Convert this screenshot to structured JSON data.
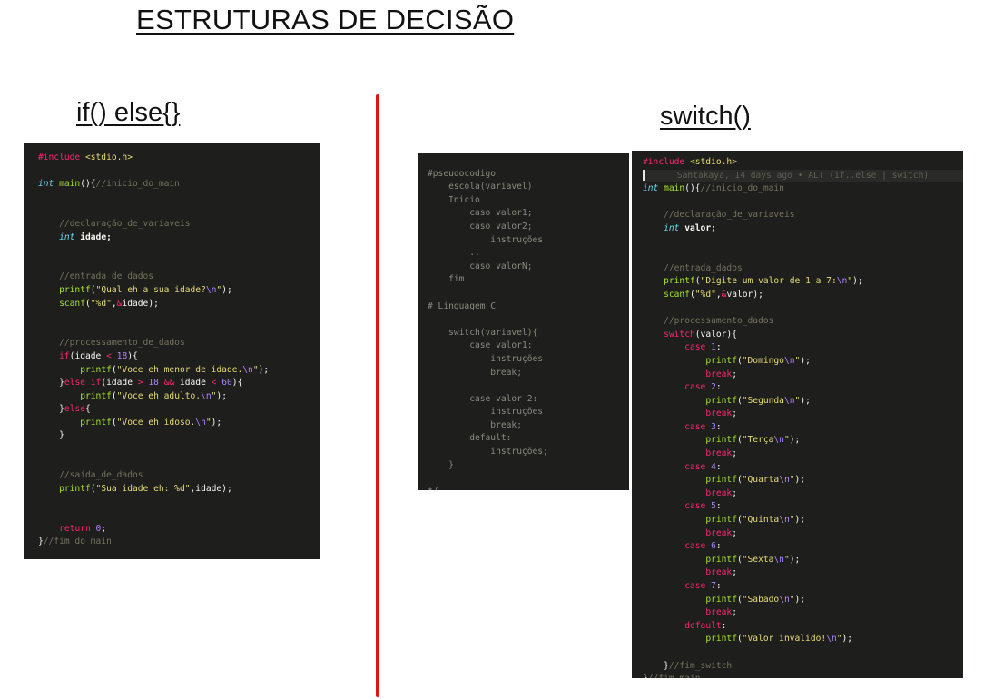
{
  "page": {
    "title": "ESTRUTURAS DE DECISÃO",
    "left_heading": "if()  else{}",
    "right_heading": "switch()"
  },
  "colors": {
    "divider": "#e01515",
    "editor_bg": "#1e1f1c",
    "keyword": "#f92672",
    "type": "#66d9ef",
    "function": "#a6e22e",
    "string": "#e6db74",
    "number": "#ae81ff",
    "comment": "#75715e"
  },
  "if_else_code": [
    [
      [
        "kw",
        "#include "
      ],
      [
        "st",
        "<stdio.h>"
      ]
    ],
    [],
    [
      [
        "ty",
        "int "
      ],
      [
        "fn",
        "main"
      ],
      [
        "pl",
        "(){"
      ],
      [
        "cm",
        "//inicio_do_main"
      ]
    ],
    [],
    [],
    [
      [
        "pl",
        "    "
      ],
      [
        "cm",
        "//declaração_de_variaveis"
      ]
    ],
    [
      [
        "pl",
        "    "
      ],
      [
        "ty",
        "int "
      ],
      [
        "bd",
        "idade;"
      ]
    ],
    [],
    [],
    [
      [
        "pl",
        "    "
      ],
      [
        "cm",
        "//entrada_de_dados"
      ]
    ],
    [
      [
        "pl",
        "    "
      ],
      [
        "fn",
        "printf"
      ],
      [
        "pl",
        "("
      ],
      [
        "st",
        "\"Qual eh a sua idade?"
      ],
      [
        "nu",
        "\\n"
      ],
      [
        "st",
        "\""
      ],
      [
        "pl",
        ");"
      ]
    ],
    [
      [
        "pl",
        "    "
      ],
      [
        "fn",
        "scanf"
      ],
      [
        "pl",
        "("
      ],
      [
        "st",
        "\"%d\""
      ],
      [
        "pl",
        ","
      ],
      [
        "kw",
        "&"
      ],
      [
        "pl",
        "idade);"
      ]
    ],
    [],
    [],
    [
      [
        "pl",
        "    "
      ],
      [
        "cm",
        "//processamento_de_dados"
      ]
    ],
    [
      [
        "pl",
        "    "
      ],
      [
        "kw",
        "if"
      ],
      [
        "pl",
        "(idade "
      ],
      [
        "kw",
        "< "
      ],
      [
        "nu",
        "18"
      ],
      [
        "pl",
        ")"
      ],
      [
        "pl",
        "{"
      ]
    ],
    [
      [
        "pl",
        "        "
      ],
      [
        "fn",
        "printf"
      ],
      [
        "pl",
        "("
      ],
      [
        "st",
        "\"Voce eh menor de idade."
      ],
      [
        "nu",
        "\\n"
      ],
      [
        "st",
        "\""
      ],
      [
        "pl",
        ");"
      ]
    ],
    [
      [
        "pl",
        "    "
      ],
      [
        "pl",
        "}"
      ],
      [
        "kw",
        "else if"
      ],
      [
        "pl",
        "(idade "
      ],
      [
        "kw",
        "> "
      ],
      [
        "nu",
        "18 "
      ],
      [
        "kw",
        "&& "
      ],
      [
        "pl",
        "idade "
      ],
      [
        "kw",
        "< "
      ],
      [
        "nu",
        "60"
      ],
      [
        "pl",
        "){"
      ]
    ],
    [
      [
        "pl",
        "        "
      ],
      [
        "fn",
        "printf"
      ],
      [
        "pl",
        "("
      ],
      [
        "st",
        "\"Voce eh adulto."
      ],
      [
        "nu",
        "\\n"
      ],
      [
        "st",
        "\""
      ],
      [
        "pl",
        ");"
      ]
    ],
    [
      [
        "pl",
        "    "
      ],
      [
        "pl",
        "}"
      ],
      [
        "kw",
        "else"
      ],
      [
        "pl",
        "{"
      ]
    ],
    [
      [
        "pl",
        "        "
      ],
      [
        "fn",
        "printf"
      ],
      [
        "pl",
        "("
      ],
      [
        "st",
        "\"Voce eh idoso."
      ],
      [
        "nu",
        "\\n"
      ],
      [
        "st",
        "\""
      ],
      [
        "pl",
        ");"
      ]
    ],
    [
      [
        "pl",
        "    }"
      ]
    ],
    [],
    [],
    [
      [
        "pl",
        "    "
      ],
      [
        "cm",
        "//saida_de_dados"
      ]
    ],
    [
      [
        "pl",
        "    "
      ],
      [
        "fn",
        "printf"
      ],
      [
        "pl",
        "("
      ],
      [
        "st",
        "\"Sua idade eh: %d\""
      ],
      [
        "pl",
        ",idade);"
      ]
    ],
    [],
    [],
    [
      [
        "pl",
        "    "
      ],
      [
        "kw",
        "return "
      ],
      [
        "nu",
        "0"
      ],
      [
        "pl",
        ";"
      ]
    ],
    [
      [
        "pl",
        "}"
      ],
      [
        "cm",
        "//fim_do_main"
      ]
    ]
  ],
  "pseudo_code": [
    [],
    [
      [
        "ps",
        "#pseudocodigo"
      ]
    ],
    [
      [
        "ps",
        "    escola(variavel)"
      ]
    ],
    [
      [
        "ps",
        "    Inicio"
      ]
    ],
    [
      [
        "ps",
        "        caso valor1;"
      ]
    ],
    [
      [
        "ps",
        "        caso valor2;"
      ]
    ],
    [
      [
        "ps",
        "            instruções"
      ]
    ],
    [
      [
        "ps",
        "        .."
      ]
    ],
    [
      [
        "ps",
        "        caso valorN;"
      ]
    ],
    [
      [
        "ps",
        "    fim"
      ]
    ],
    [],
    [
      [
        "ps",
        "# Linguagem C"
      ]
    ],
    [],
    [
      [
        "ps",
        "    switch(variavel){"
      ]
    ],
    [
      [
        "ps",
        "        case valor1:"
      ]
    ],
    [
      [
        "ps",
        "            instruções"
      ]
    ],
    [
      [
        "ps",
        "            break;"
      ]
    ],
    [],
    [
      [
        "ps",
        "        case valor 2:"
      ]
    ],
    [
      [
        "ps",
        "            instruções"
      ]
    ],
    [
      [
        "ps",
        "            break;"
      ]
    ],
    [
      [
        "ps",
        "        default:"
      ]
    ],
    [
      [
        "ps",
        "            instruções;"
      ]
    ],
    [
      [
        "ps",
        "    }"
      ]
    ],
    [],
    [
      [
        "ps",
        "*/"
      ]
    ]
  ],
  "switch_blame": "     Santakaya, 14 days ago • ALT (if..else | switch)",
  "switch_code": [
    [
      [
        "kw",
        "#include "
      ],
      [
        "st",
        "<stdio.h>"
      ]
    ],
    "BLAME",
    [
      [
        "ty",
        "int "
      ],
      [
        "fn",
        "main"
      ],
      [
        "pl",
        "(){"
      ],
      [
        "cm",
        "//inicio_do_main"
      ]
    ],
    [],
    [
      [
        "pl",
        "    "
      ],
      [
        "cm",
        "//declaração_de_variaveis"
      ]
    ],
    [
      [
        "pl",
        "    "
      ],
      [
        "ty",
        "int "
      ],
      [
        "bd",
        "valor;"
      ]
    ],
    [],
    [],
    [
      [
        "pl",
        "    "
      ],
      [
        "cm",
        "//entrada_dados"
      ]
    ],
    [
      [
        "pl",
        "    "
      ],
      [
        "fn",
        "printf"
      ],
      [
        "pl",
        "("
      ],
      [
        "st",
        "\"Digite um valor de 1 a 7:"
      ],
      [
        "nu",
        "\\n"
      ],
      [
        "st",
        "\""
      ],
      [
        "pl",
        ");"
      ]
    ],
    [
      [
        "pl",
        "    "
      ],
      [
        "fn",
        "scanf"
      ],
      [
        "pl",
        "("
      ],
      [
        "st",
        "\"%d\""
      ],
      [
        "pl",
        ","
      ],
      [
        "kw",
        "&"
      ],
      [
        "pl",
        "valor);"
      ]
    ],
    [],
    [
      [
        "pl",
        "    "
      ],
      [
        "cm",
        "//processamento_dados"
      ]
    ],
    [
      [
        "pl",
        "    "
      ],
      [
        "kw",
        "switch"
      ],
      [
        "pl",
        "(valor){"
      ]
    ],
    [
      [
        "pl",
        "        "
      ],
      [
        "kw",
        "case "
      ],
      [
        "nu",
        "1"
      ],
      [
        "pl",
        ":"
      ]
    ],
    [
      [
        "pl",
        "            "
      ],
      [
        "fn",
        "printf"
      ],
      [
        "pl",
        "("
      ],
      [
        "st",
        "\"Domingo"
      ],
      [
        "nu",
        "\\n"
      ],
      [
        "st",
        "\""
      ],
      [
        "pl",
        ");"
      ]
    ],
    [
      [
        "pl",
        "            "
      ],
      [
        "kw",
        "break"
      ],
      [
        "pl",
        ";"
      ]
    ],
    [
      [
        "pl",
        "        "
      ],
      [
        "kw",
        "case "
      ],
      [
        "nu",
        "2"
      ],
      [
        "pl",
        ":"
      ]
    ],
    [
      [
        "pl",
        "            "
      ],
      [
        "fn",
        "printf"
      ],
      [
        "pl",
        "("
      ],
      [
        "st",
        "\"Segunda"
      ],
      [
        "nu",
        "\\n"
      ],
      [
        "st",
        "\""
      ],
      [
        "pl",
        ");"
      ]
    ],
    [
      [
        "pl",
        "            "
      ],
      [
        "kw",
        "break"
      ],
      [
        "pl",
        ";"
      ]
    ],
    [
      [
        "pl",
        "        "
      ],
      [
        "kw",
        "case "
      ],
      [
        "nu",
        "3"
      ],
      [
        "pl",
        ":"
      ]
    ],
    [
      [
        "pl",
        "            "
      ],
      [
        "fn",
        "printf"
      ],
      [
        "pl",
        "("
      ],
      [
        "st",
        "\"Terça"
      ],
      [
        "nu",
        "\\n"
      ],
      [
        "st",
        "\""
      ],
      [
        "pl",
        ");"
      ]
    ],
    [
      [
        "pl",
        "            "
      ],
      [
        "kw",
        "break"
      ],
      [
        "pl",
        ";"
      ]
    ],
    [
      [
        "pl",
        "        "
      ],
      [
        "kw",
        "case "
      ],
      [
        "nu",
        "4"
      ],
      [
        "pl",
        ":"
      ]
    ],
    [
      [
        "pl",
        "            "
      ],
      [
        "fn",
        "printf"
      ],
      [
        "pl",
        "("
      ],
      [
        "st",
        "\"Quarta"
      ],
      [
        "nu",
        "\\n"
      ],
      [
        "st",
        "\""
      ],
      [
        "pl",
        ");"
      ]
    ],
    [
      [
        "pl",
        "            "
      ],
      [
        "kw",
        "break"
      ],
      [
        "pl",
        ";"
      ]
    ],
    [
      [
        "pl",
        "        "
      ],
      [
        "kw",
        "case "
      ],
      [
        "nu",
        "5"
      ],
      [
        "pl",
        ":"
      ]
    ],
    [
      [
        "pl",
        "            "
      ],
      [
        "fn",
        "printf"
      ],
      [
        "pl",
        "("
      ],
      [
        "st",
        "\"Quinta"
      ],
      [
        "nu",
        "\\n"
      ],
      [
        "st",
        "\""
      ],
      [
        "pl",
        ");"
      ]
    ],
    [
      [
        "pl",
        "            "
      ],
      [
        "kw",
        "break"
      ],
      [
        "pl",
        ";"
      ]
    ],
    [
      [
        "pl",
        "        "
      ],
      [
        "kw",
        "case "
      ],
      [
        "nu",
        "6"
      ],
      [
        "pl",
        ":"
      ]
    ],
    [
      [
        "pl",
        "            "
      ],
      [
        "fn",
        "printf"
      ],
      [
        "pl",
        "("
      ],
      [
        "st",
        "\"Sexta"
      ],
      [
        "nu",
        "\\n"
      ],
      [
        "st",
        "\""
      ],
      [
        "pl",
        ");"
      ]
    ],
    [
      [
        "pl",
        "            "
      ],
      [
        "kw",
        "break"
      ],
      [
        "pl",
        ";"
      ]
    ],
    [
      [
        "pl",
        "        "
      ],
      [
        "kw",
        "case "
      ],
      [
        "nu",
        "7"
      ],
      [
        "pl",
        ":"
      ]
    ],
    [
      [
        "pl",
        "            "
      ],
      [
        "fn",
        "printf"
      ],
      [
        "pl",
        "("
      ],
      [
        "st",
        "\"Sabado"
      ],
      [
        "nu",
        "\\n"
      ],
      [
        "st",
        "\""
      ],
      [
        "pl",
        ");"
      ]
    ],
    [
      [
        "pl",
        "            "
      ],
      [
        "kw",
        "break"
      ],
      [
        "pl",
        ";"
      ]
    ],
    [
      [
        "pl",
        "        "
      ],
      [
        "kw",
        "default"
      ],
      [
        "pl",
        ":"
      ]
    ],
    [
      [
        "pl",
        "            "
      ],
      [
        "fn",
        "printf"
      ],
      [
        "pl",
        "("
      ],
      [
        "st",
        "\"Valor invalido!"
      ],
      [
        "nu",
        "\\n"
      ],
      [
        "st",
        "\""
      ],
      [
        "pl",
        ");"
      ]
    ],
    [],
    [
      [
        "pl",
        "    }"
      ],
      [
        "cm",
        "//fim_switch"
      ]
    ],
    [
      [
        "pl",
        "}"
      ],
      [
        "cm",
        "//fim_main"
      ]
    ]
  ]
}
